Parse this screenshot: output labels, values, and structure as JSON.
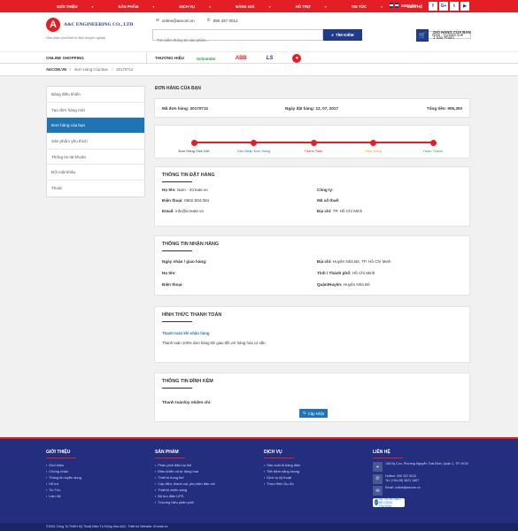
{
  "topnav": {
    "items": [
      "GIỚI THIỆU",
      "SẢN PHẨM",
      "DỊCH VỤ",
      "BẢNG GIÁ",
      "HỖ TRỢ",
      "TIN TỨC",
      "LIÊN HỆ"
    ],
    "language": "ENGLISH",
    "social": [
      "f",
      "G+",
      "t",
      "▶"
    ]
  },
  "header": {
    "logo_text": "A&C ENGINEERING CO., LTD",
    "slogan": "Nhà phân phối thiết bị điện chuyên nghiệp",
    "email": "online@aecom.vn",
    "phone": "090 337 0012",
    "search_placeholder": "Tìm kiếm thông tin sản phẩm...",
    "search_button": "TÌM KIẾM",
    "user_menu": "Nam - iCreate.vn",
    "cart_title": "GIỎ HÀNG CỦA BẠN",
    "cart_count": "1 Sản Phẩm"
  },
  "shopbar": {
    "online": "ONLINE SHOPPING",
    "brands_label": "THƯƠNG HIỆU",
    "brands": [
      "Schneider",
      "ABB",
      "LS",
      "●"
    ]
  },
  "breadcrumb": [
    "AECOM.VN",
    "Đơn Hàng Của Bạn",
    "20170712"
  ],
  "sidebar": {
    "items": [
      "Bảng điều khiển",
      "Tạo đơn hàng mới",
      "Đơn hàng của bạn",
      "Sản phẩm yêu thích",
      "Thông tin tài khoản",
      "Đổi mật khẩu",
      "Thoát"
    ],
    "active_index": 2
  },
  "order": {
    "title": "ĐƠN HÀNG CỦA BẠN",
    "code_label": "Mã đơn hàng:",
    "code": "20170712",
    "date_label": "Ngày đặt hàng:",
    "date": "12, 07, 2017",
    "total_label": "Tổng tiền:",
    "total": "905,300"
  },
  "progress": {
    "steps": [
      {
        "label": "Đơn Hàng Vừa Gửi",
        "color": "#333333"
      },
      {
        "label": "Xác Nhận Đơn Hàng",
        "color": "#1f74b4"
      },
      {
        "label": "Thanh Toán",
        "color": "#e31e24"
      },
      {
        "label": "Giao Hàng",
        "color": "#f0a500"
      },
      {
        "label": "Hoàn Thành",
        "color": "#2a9d3e"
      }
    ]
  },
  "buyer": {
    "title": "THÔNG TIN ĐẶT HÀNG",
    "name_label": "Họ tên:",
    "name": "Nam - iCreate.vn",
    "phone_label": "Điện thoại:",
    "phone": "0902.804.084",
    "email_label": "Email:",
    "email": "info@icreate.vn",
    "company_label": "Công ty:",
    "company": "",
    "tax_label": "Mã số thuế:",
    "tax": "",
    "address_label": "Địa chỉ:",
    "address": "TP. Hồ Chí Minh"
  },
  "receiver": {
    "title": "THÔNG TIN NHẬN HÀNG",
    "date_label": "Ngày nhận / giao hàng:",
    "date": "",
    "name_label": "Họ tên:",
    "name": "",
    "phone_label": "Điện thoại:",
    "phone": "",
    "address_label": "Địa chỉ:",
    "address": "Huyện Nhà Bè, TP. Hồ Chí Minh",
    "province_label": "Tỉnh / Thành phố:",
    "province": "Hồ Chí Minh",
    "district_label": "Quận/Huyện:",
    "district": "Huyện Nhà Bè"
  },
  "payment": {
    "title": "HÌNH THỨC THANH TOÁN",
    "method": "Thanh toán khi nhận hàng",
    "note": "Thanh toán 100% đơn hàng khi giao đối với hàng hóa có sẵn."
  },
  "attachment": {
    "title": "THÔNG TIN ĐÍNH KÈM",
    "label": "Thanh toán/ủy nhiệm chi:",
    "button": "Cập Nhật"
  },
  "footer": {
    "about_title": "GIỚI THIỆU",
    "about": [
      "Giới thiệu",
      "Chứng nhận",
      "Thông tin tuyển dụng",
      "Hỗ trợ",
      "Tin Tức",
      "Liên Hệ"
    ],
    "products_title": "SẢN PHẨM",
    "products": [
      "Phân phối điện hạ thế",
      "Điều khiển và tự động hóa",
      "Thiết bị trung thế",
      "Cáp điện, thanh cái, phụ kiện đầu nối",
      "Thiết bị chiếu sáng",
      "Bộ lưu điện UPS",
      "Thương hiệu phân phối"
    ],
    "services_title": "DỊCH VỤ",
    "services": [
      "Sản xuất tủ bảng điện",
      "Tiết kiệm năng lượng",
      "Dịch vụ kỹ thuật",
      "Thực Hiện Dự Án"
    ],
    "contact_title": "LIÊN HỆ",
    "address": "108 Ký Con, Phường Nguyễn Thái Bình, Quận 1, TP. HCM",
    "hotline": "Hotline: 090 337 0012",
    "tel": "Tel: (+84-28) 3821 1667",
    "email": "Email: online@aecom.vn",
    "badge": "ĐÃ THÔNG BÁO BỘ CÔNG THƯƠNG",
    "copyright": "©2001 Công Ty TNHH Kỹ Thuật Điện Tự Động Hóa A&C. Thiết kế Website: iCreate.vn"
  }
}
